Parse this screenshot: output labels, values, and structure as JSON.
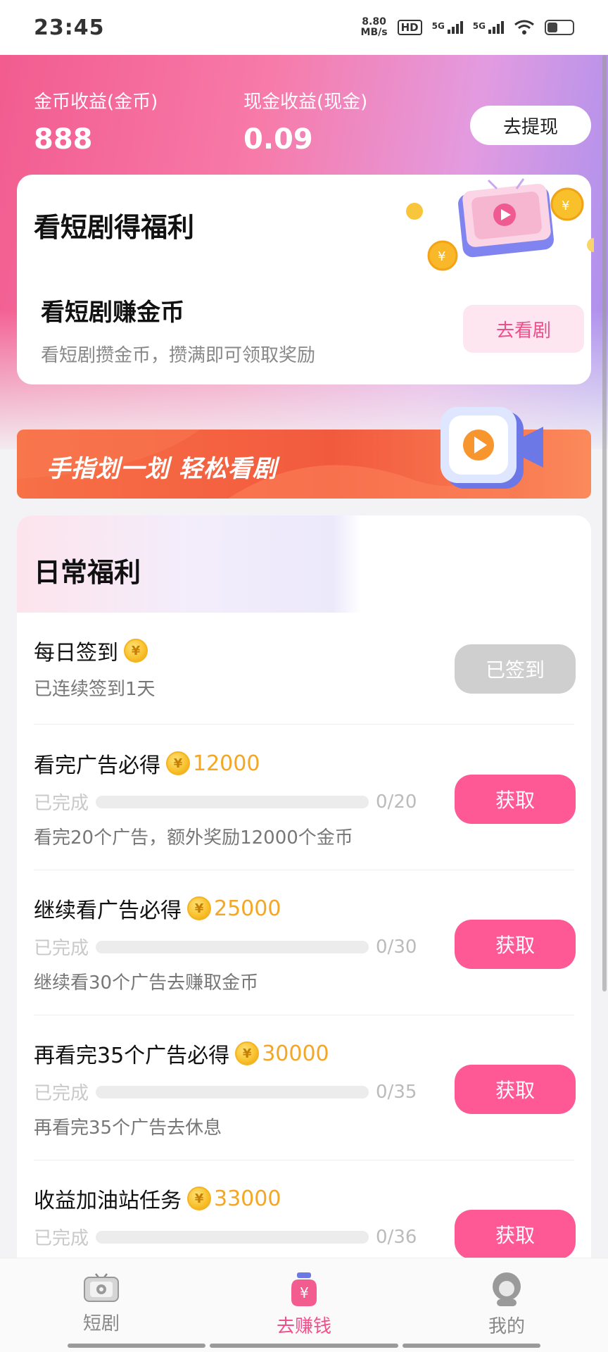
{
  "status_bar": {
    "time": "23:45",
    "net_speed_value": "8.80",
    "net_speed_unit": "MB/s",
    "hd_label": "HD",
    "signal_1_label": "5G",
    "signal_2_label": "5G",
    "battery_level": 0.4
  },
  "earnings": {
    "coin_label": "金币收益(金币)",
    "coin_value": "888",
    "cash_label": "现金收益(现金)",
    "cash_value": "0.09",
    "withdraw_button": "去提现"
  },
  "drama_card": {
    "title": "看短剧得福利",
    "subtitle": "看短剧赚金币",
    "description": "看短剧攒金币，攒满即可领取奖励",
    "button": "去看剧"
  },
  "banner": {
    "text": "手指划一划 轻松看剧"
  },
  "daily": {
    "title": "日常福利",
    "tasks": [
      {
        "title": "每日签到",
        "reward": "",
        "description": "已连续签到1天",
        "button": "已签到",
        "has_progress": false
      },
      {
        "title": "看完广告必得",
        "reward": "12000",
        "progress_label": "已完成",
        "progress_count": "0/20",
        "progress_fraction": 0,
        "description": "看完20个广告，额外奖励12000个金币",
        "button": "获取",
        "has_progress": true
      },
      {
        "title": "继续看广告必得",
        "reward": "25000",
        "progress_label": "已完成",
        "progress_count": "0/30",
        "progress_fraction": 0,
        "description": "继续看30个广告去赚取金币",
        "button": "获取",
        "has_progress": true
      },
      {
        "title": "再看完35个广告必得",
        "reward": "30000",
        "progress_label": "已完成",
        "progress_count": "0/35",
        "progress_fraction": 0,
        "description": "再看完35个广告去休息",
        "button": "获取",
        "has_progress": true
      },
      {
        "title": "收益加油站任务",
        "reward": "33000",
        "progress_label": "已完成",
        "progress_count": "0/36",
        "progress_fraction": 0,
        "description": "",
        "button": "获取",
        "has_progress": true
      }
    ]
  },
  "bottom_nav": {
    "items": [
      {
        "label": "短剧",
        "icon": "tv-icon",
        "active": false
      },
      {
        "label": "去赚钱",
        "icon": "money-bag-icon",
        "active": true
      },
      {
        "label": "我的",
        "icon": "profile-icon",
        "active": false
      }
    ]
  },
  "colors": {
    "accent_pink": "#fe5895",
    "coin_gold": "#f5a623",
    "banner_orange": "#f25a3e",
    "disabled_gray": "#cfcfcf"
  }
}
